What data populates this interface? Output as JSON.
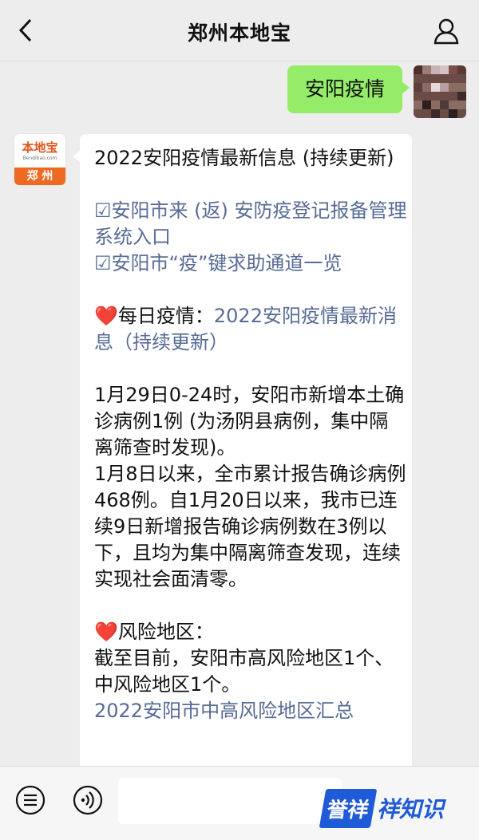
{
  "header": {
    "title": "郑州本地宝"
  },
  "outgoing": {
    "text": "安阳疫情"
  },
  "bot": {
    "logo_text": "本地宝",
    "logo_url": "Bendibao.com",
    "logo_city": "郑 州"
  },
  "message": {
    "title": "2022安阳疫情最新信息 (持续更新)",
    "link1": "☑安阳市来 (返) 安防疫登记报备管理系统入口",
    "link2": "☑安阳市“疫”键求助通道一览",
    "daily_heart": "❤️",
    "daily_label": "每日疫情：",
    "daily_link": "2022安阳疫情最新消息（持续更新）",
    "report": "1月29日0-24时，安阳市新增本土确诊病例1例 (为汤阴县病例，集中隔离筛查时发现)。",
    "summary": "1月8日以来，全市累计报告确诊病例468例。自1月20日以来，我市已连续9日新增报告确诊病例数在3例以下，且均为集中隔离筛查发现，连续实现社会面清零。",
    "risk_heart": "❤️",
    "risk_label": "风险地区：",
    "risk_text": "截至目前，安阳市高风险地区1个、中风险地区1个。",
    "risk_link": "2022安阳市中高风险地区汇总"
  },
  "watermark": {
    "badge": "誉祥",
    "text": "祥知识"
  },
  "colors": {
    "link": "#576b95",
    "outgoing_bubble": "#95ec69",
    "background": "#ededed"
  }
}
